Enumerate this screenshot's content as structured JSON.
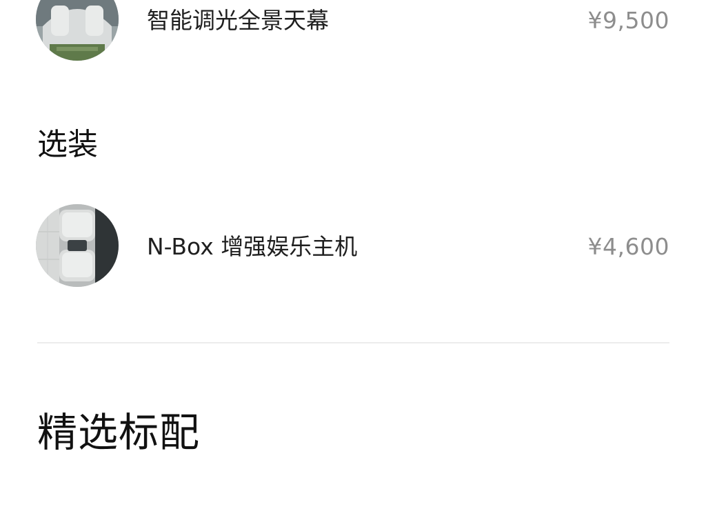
{
  "items_top": [
    {
      "name": "智能调光全景天幕",
      "price": "¥9,500",
      "image": "panoramic-sunroof-thumbnail"
    }
  ],
  "options_section": {
    "title": "选装",
    "items": [
      {
        "name": "N-Box 增强娱乐主机",
        "price": "¥4,600",
        "image": "n-box-entertainment-thumbnail"
      }
    ]
  },
  "featured_section": {
    "title": "精选标配"
  },
  "colors": {
    "price": "#8d8d8d",
    "divider": "#ececec",
    "text": "#1a1a1a"
  }
}
